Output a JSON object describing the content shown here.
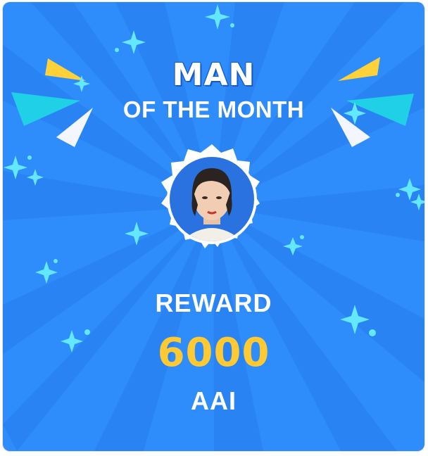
{
  "title": {
    "line1": "MAN",
    "line2": "OF THE MONTH"
  },
  "reward": {
    "label": "REWARD",
    "amount": "6000",
    "unit": "AAI"
  },
  "colors": {
    "background": "#2f8dfb",
    "rays": "#2a84f2",
    "accent_yellow": "#ffc933",
    "sparkle": "#63e8ff"
  },
  "icons": [
    "sparkle-icon",
    "confetti-triangle-icon",
    "avatar-badge"
  ]
}
